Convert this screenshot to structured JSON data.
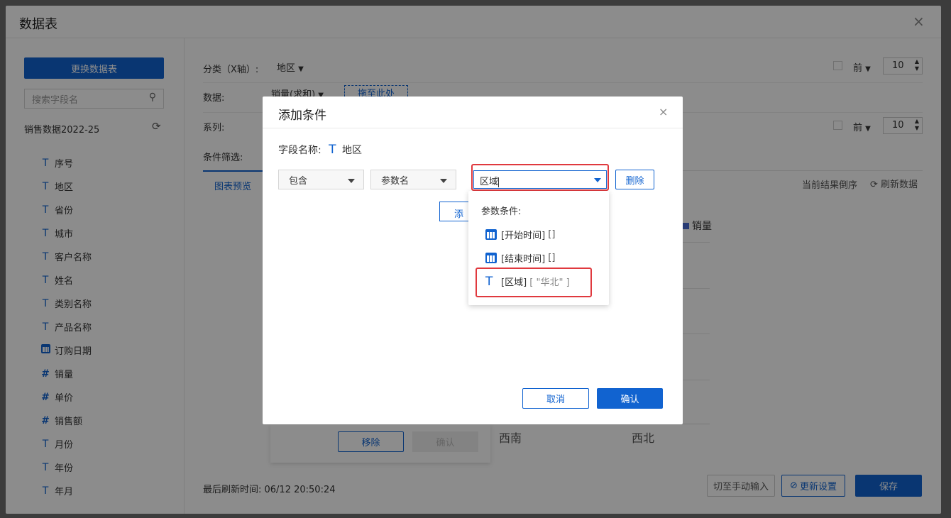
{
  "outer": {
    "title": "数据表",
    "close": "×",
    "change_table_button": "更换数据表",
    "search_placeholder": "搜索字段名",
    "table_name": "销售数据2022-25",
    "fields": [
      {
        "icon": "T",
        "label": "序号"
      },
      {
        "icon": "T",
        "label": "地区"
      },
      {
        "icon": "T",
        "label": "省份"
      },
      {
        "icon": "T",
        "label": "城市"
      },
      {
        "icon": "T",
        "label": "客户名称"
      },
      {
        "icon": "T",
        "label": "姓名"
      },
      {
        "icon": "T",
        "label": "类别名称"
      },
      {
        "icon": "T",
        "label": "产品名称"
      },
      {
        "icon": "calendar",
        "label": "订购日期"
      },
      {
        "icon": "#",
        "label": "销量"
      },
      {
        "icon": "#",
        "label": "单价"
      },
      {
        "icon": "#",
        "label": "销售额"
      },
      {
        "icon": "T",
        "label": "月份"
      },
      {
        "icon": "T",
        "label": "年份"
      },
      {
        "icon": "T",
        "label": "年月"
      }
    ],
    "xaxis_label": "分类（X轴）:",
    "xaxis_value": "地区",
    "data_label": "数据:",
    "data_value": "销量(求和)",
    "drag_here": "拖至此处",
    "series_label": "系列:",
    "filter_label": "条件筛选:",
    "top_label": "前",
    "top_value_1": "10",
    "top_value_2": "10",
    "tab_preview": "图表预览",
    "reverse_label": "当前结果倒序",
    "refresh_label": "刷新数据",
    "legend_series": "销量",
    "x_categories": [
      "西南",
      "西北"
    ],
    "remove_button": "移除",
    "inner_confirm": "确认",
    "last_refresh": "最后刷新时间: 06/12 20:50:24",
    "manual_button": "切至手动输入",
    "update_button": "更新设置",
    "save_button": "保存"
  },
  "dialog": {
    "title": "添加条件",
    "close": "×",
    "field_name_label": "字段名称:",
    "field_name_value": "地区",
    "op_value": "包含",
    "param_value": "参数名",
    "param_input_value": "区域",
    "delete_button": "删除",
    "add_button": "添加",
    "cancel_button": "取消",
    "confirm_button": "确认",
    "dropdown": {
      "header": "参数条件:",
      "items": [
        {
          "icon": "calendar",
          "name": "[开始时间]",
          "value": "[]"
        },
        {
          "icon": "T",
          "name": "[结束时间]",
          "value": "[]"
        },
        {
          "icon": "T",
          "name": "[区域]",
          "value": "[ \"华北\" ]"
        }
      ]
    }
  },
  "colors": {
    "accent": "#1163d0",
    "highlight": "#e0393e"
  }
}
